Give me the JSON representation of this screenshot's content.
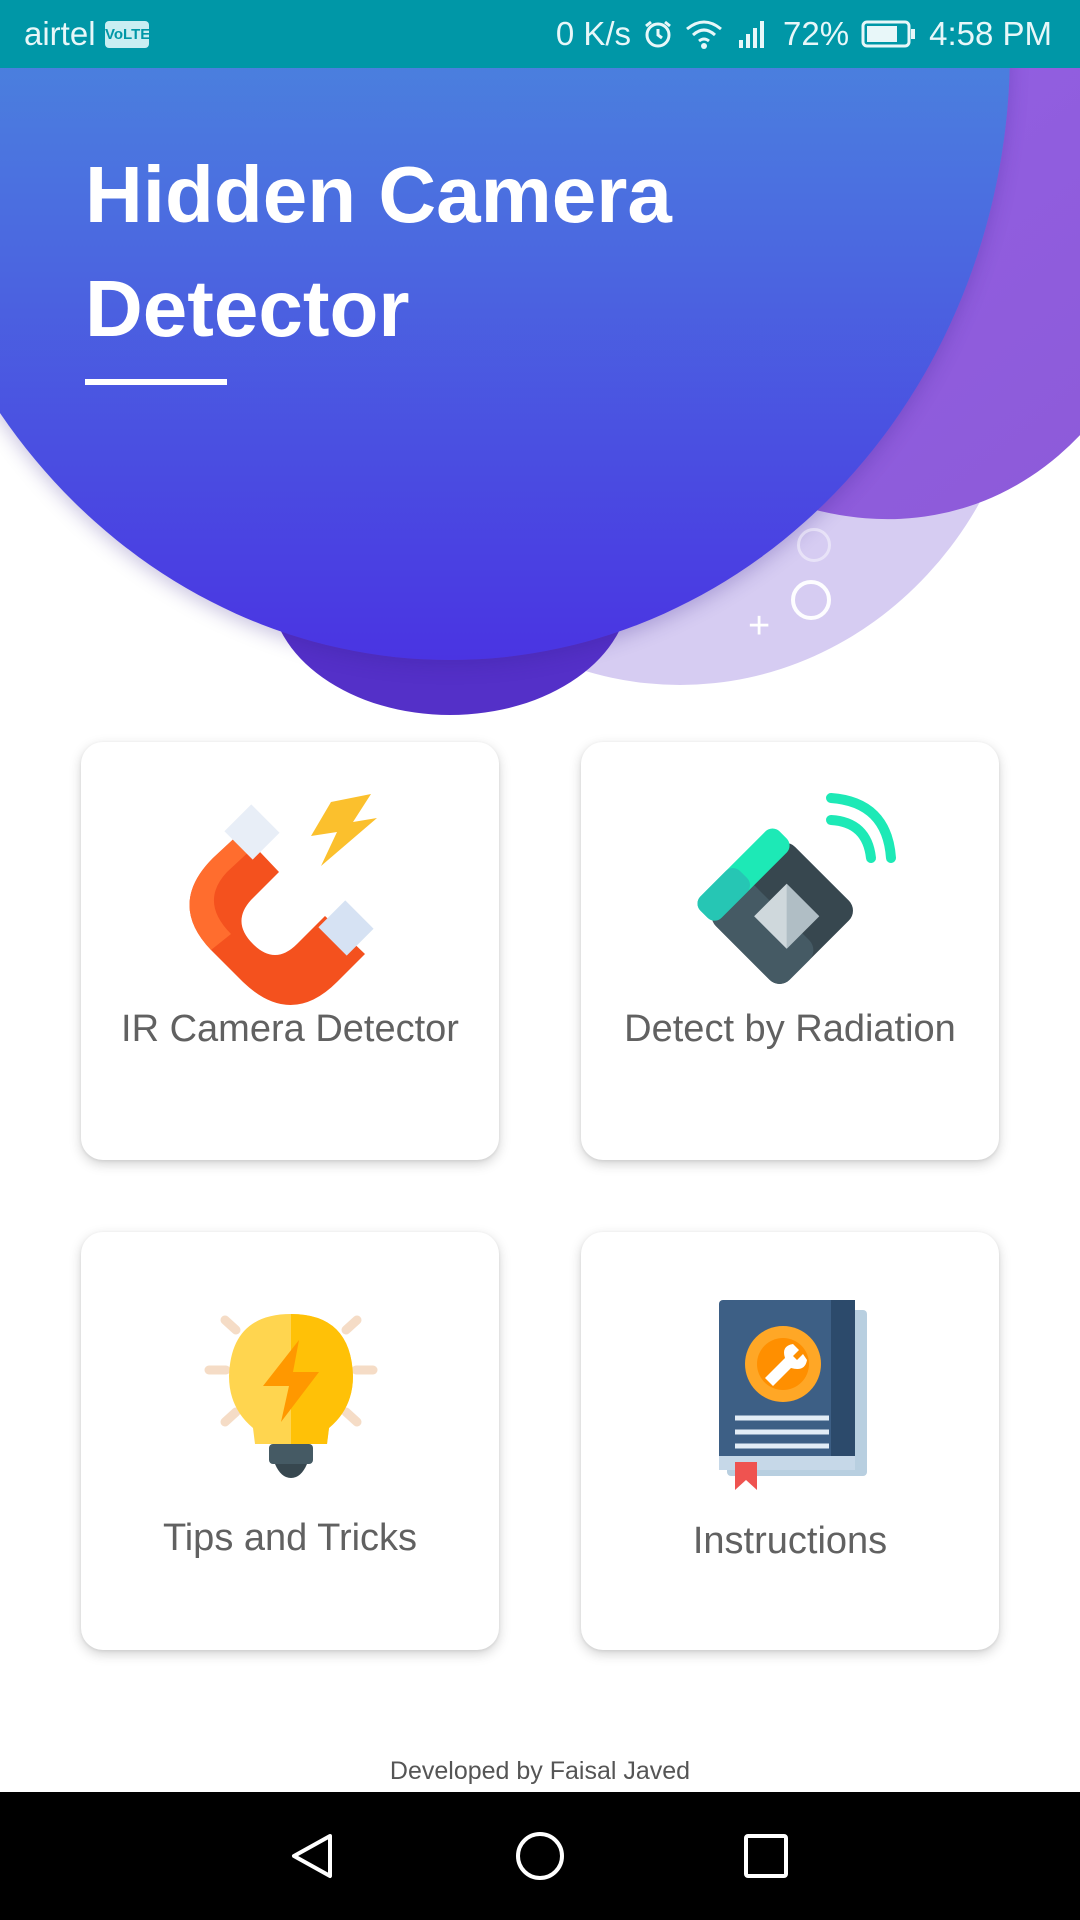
{
  "status_bar": {
    "carrier": "airtel",
    "volte": "VoLTE",
    "speed": "0 K/s",
    "battery": "72%",
    "time": "4:58 PM",
    "icons": [
      "alarm-icon",
      "wifi-icon",
      "signal-icon",
      "battery-icon"
    ]
  },
  "header": {
    "title": "Hidden Camera Detector",
    "colors": {
      "top": "#4bb3d7",
      "bottom": "#4a34e2",
      "accent_purple": "#9a64ec",
      "lilac": "#d6ccf2"
    }
  },
  "cards": [
    {
      "label": "IR Camera Detector",
      "icon": "magnet-icon"
    },
    {
      "label": "Detect by Radiation",
      "icon": "remote-signal-icon"
    },
    {
      "label": "Tips and Tricks",
      "icon": "lightbulb-icon"
    },
    {
      "label": "Instructions",
      "icon": "manual-book-icon"
    }
  ],
  "footer": {
    "text": "Developed by Faisal Javed"
  },
  "nav": {
    "icons": [
      "back-icon",
      "home-icon",
      "recent-apps-icon"
    ]
  }
}
